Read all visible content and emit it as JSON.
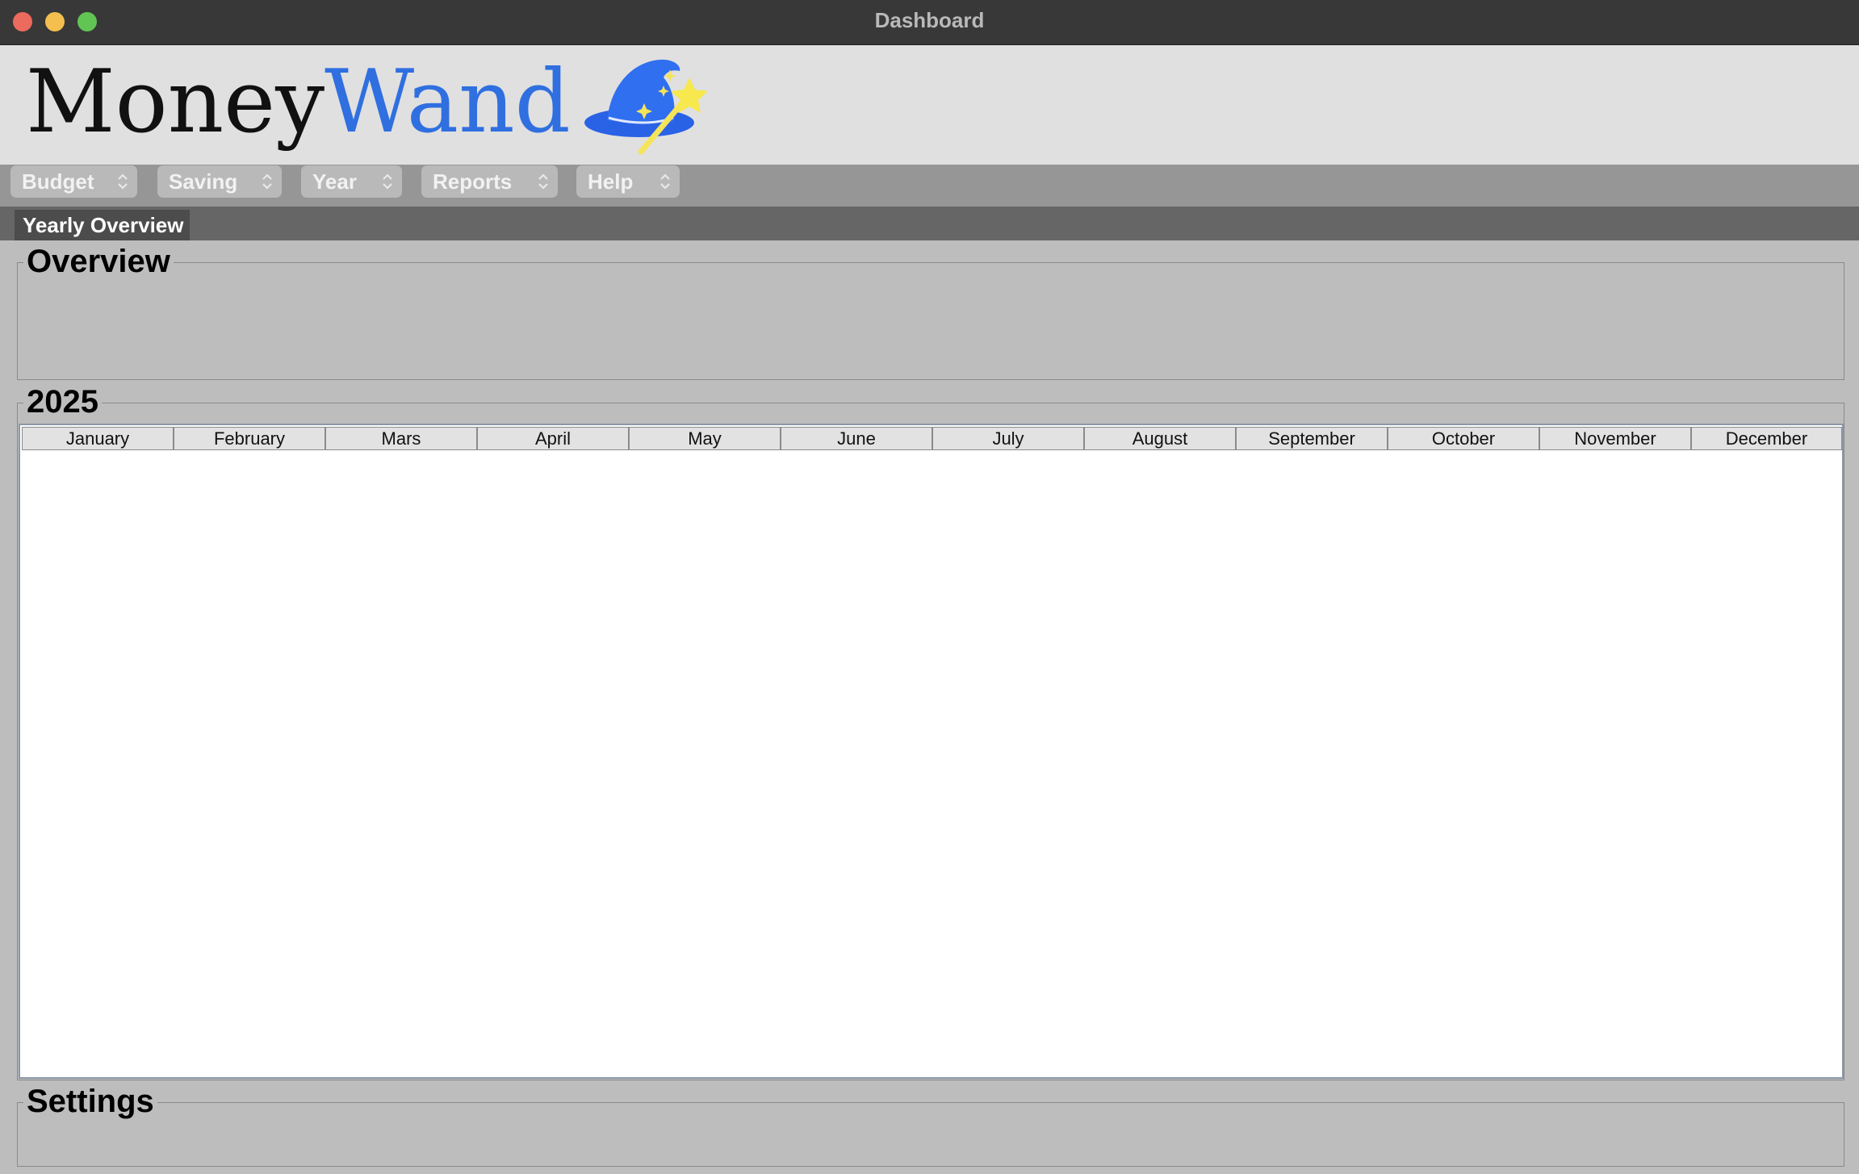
{
  "window": {
    "title": "Dashboard"
  },
  "logo": {
    "part1": "Money",
    "part2": "Wand",
    "icon": "wizard-hat-icon"
  },
  "menu": {
    "items": [
      {
        "label": "Budget"
      },
      {
        "label": "Saving"
      },
      {
        "label": "Year"
      },
      {
        "label": "Reports"
      },
      {
        "label": "Help"
      }
    ]
  },
  "tabs": {
    "active": "Yearly Overview"
  },
  "groups": {
    "overview": "Overview",
    "year": "2025",
    "settings": "Settings"
  },
  "table": {
    "columns": [
      "January",
      "February",
      "Mars",
      "April",
      "May",
      "June",
      "July",
      "August",
      "September",
      "October",
      "November",
      "December"
    ]
  },
  "colors": {
    "accent": "#2f6fe0",
    "titlebar": "#383838",
    "close": "#ed6a5e",
    "minimize": "#f4bf4f",
    "maximize": "#61c554"
  }
}
